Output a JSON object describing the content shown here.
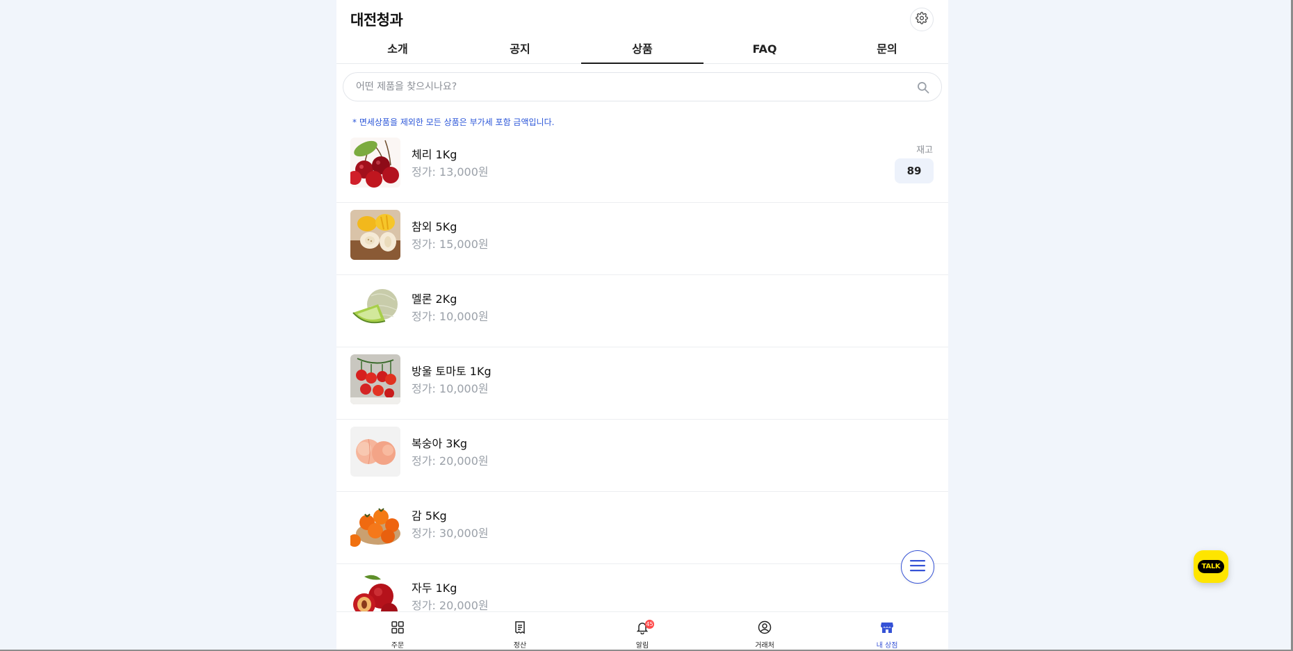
{
  "header": {
    "title": "대전청과"
  },
  "tabs": [
    {
      "label": "소개",
      "active": false
    },
    {
      "label": "공지",
      "active": false
    },
    {
      "label": "상품",
      "active": true
    },
    {
      "label": "FAQ",
      "active": false
    },
    {
      "label": "문의",
      "active": false
    }
  ],
  "search": {
    "placeholder": "어떤 제품을 찾으시나요?",
    "value": ""
  },
  "notice": "* 면세상품을 제외한 모든 상품은 부가세 포함 금액입니다.",
  "products": [
    {
      "name": "체리 1Kg",
      "price": "정가: 13,000원",
      "stock_label": "재고",
      "stock": "89"
    },
    {
      "name": "참외 5Kg",
      "price": "정가: 15,000원"
    },
    {
      "name": "멜론 2Kg",
      "price": "정가: 10,000원"
    },
    {
      "name": "방울 토마토 1Kg",
      "price": "정가: 10,000원"
    },
    {
      "name": "복숭아 3Kg",
      "price": "정가: 20,000원"
    },
    {
      "name": "감 5Kg",
      "price": "정가: 30,000원"
    },
    {
      "name": "자두 1Kg",
      "price": "정가: 20,000원"
    }
  ],
  "bottom_nav": [
    {
      "label": "주문",
      "icon": "grid-icon",
      "active": false
    },
    {
      "label": "정산",
      "icon": "receipt-icon",
      "active": false
    },
    {
      "label": "알림",
      "icon": "bell-icon",
      "active": false,
      "badge": "45"
    },
    {
      "label": "거래처",
      "icon": "user-circle-icon",
      "active": false
    },
    {
      "label": "내 상점",
      "icon": "store-icon",
      "active": true
    }
  ],
  "talk_button": {
    "label": "TALK"
  },
  "colors": {
    "accent": "#3552d6",
    "notice_text": "#2a55d8",
    "kakao_yellow": "#fee500",
    "badge_red": "#ff4b4b",
    "page_bg": "#f1f5fb"
  }
}
